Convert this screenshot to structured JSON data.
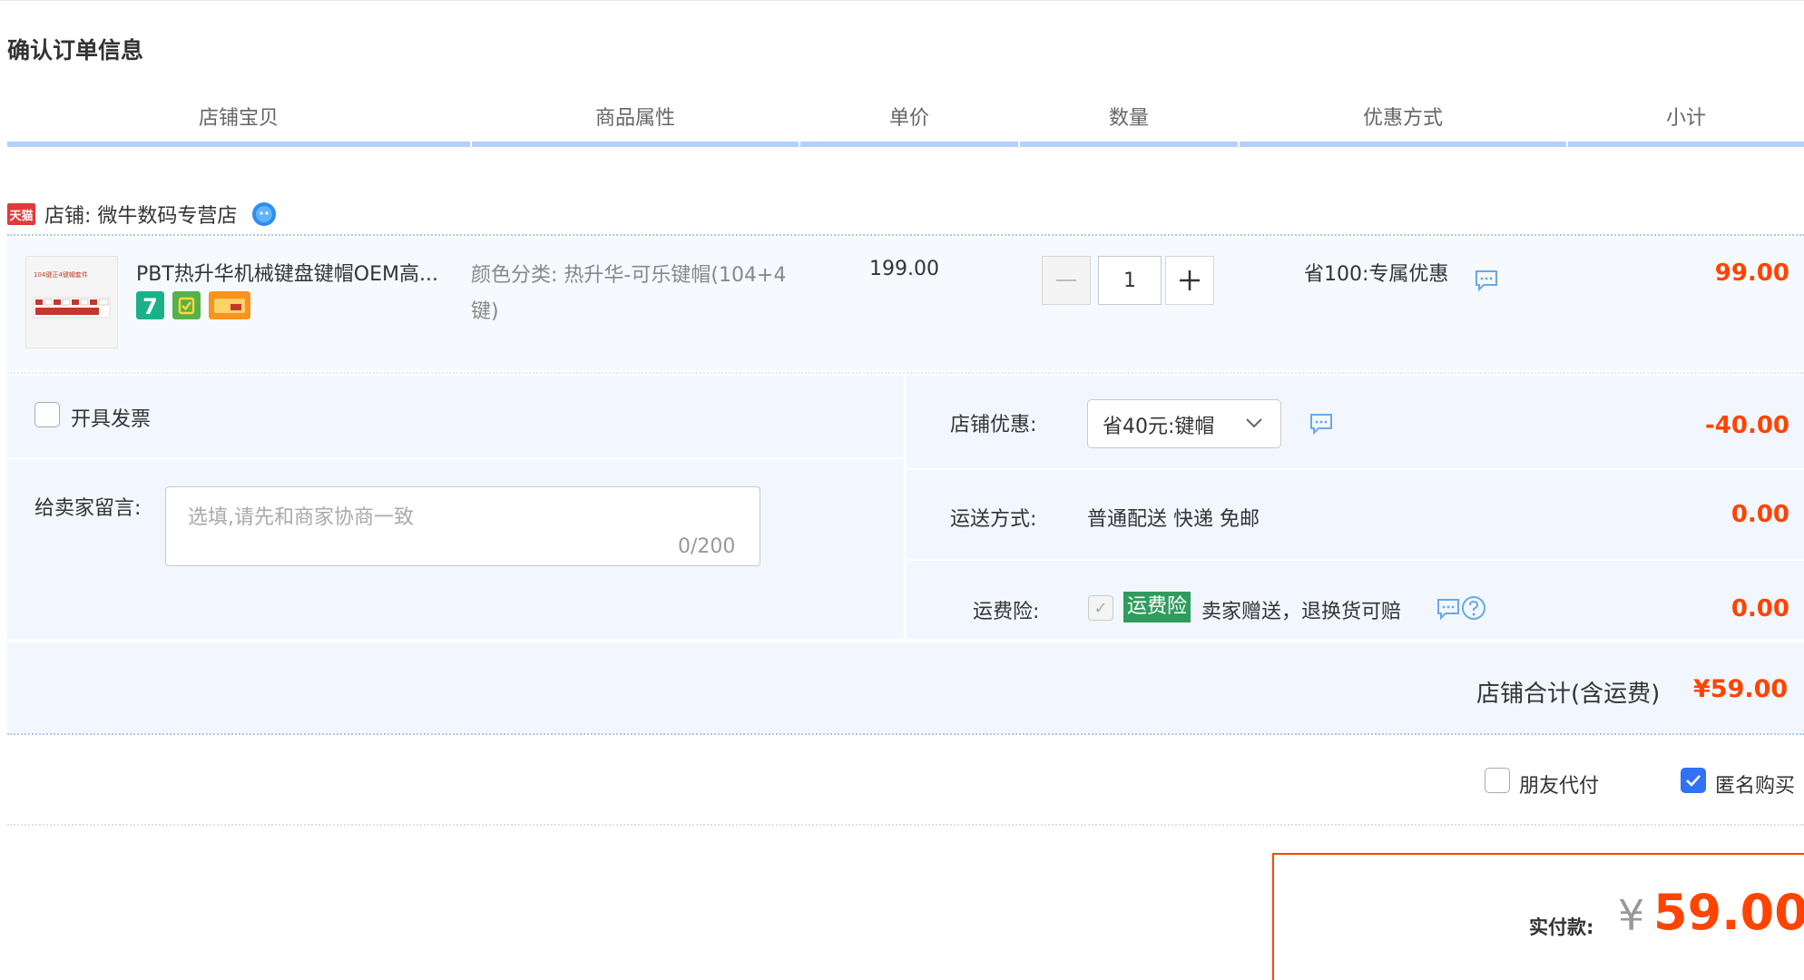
{
  "page_title": "确认订单信息",
  "columns": [
    "店铺宝贝",
    "商品属性",
    "单价",
    "数量",
    "优惠方式",
    "小计"
  ],
  "shop": {
    "badge": "天猫",
    "label": "店铺: 微牛数码专营店"
  },
  "item": {
    "title": "PBT热升华机械键盘键帽OEM高...",
    "thumb_text": "104键正4键帽套件",
    "attr_label": "颜色分类:",
    "attr_value": "热升华-可乐键帽(104+4键)",
    "price": "199.00",
    "quantity": "1",
    "promo": "省100:专属优惠",
    "subtotal": "99.00",
    "service_badges": [
      "7-day-return-icon",
      "guarantee-icon",
      "credit-card-icon"
    ],
    "service_badge_text": "7"
  },
  "invoice": {
    "label": "开具发票",
    "checked": false
  },
  "message": {
    "label": "给卖家留言:",
    "placeholder": "选填,请先和商家协商一致",
    "counter": "0/200"
  },
  "shop_discount": {
    "label": "店铺优惠:",
    "selected": "省40元:键帽",
    "amount": "-40.00"
  },
  "shipping": {
    "label": "运送方式:",
    "value": "普通配送 快递 免邮",
    "amount": "0.00"
  },
  "insurance": {
    "label": "运费险:",
    "tag": "运费险",
    "desc": "卖家赠送，退换货可赔",
    "amount": "0.00"
  },
  "shop_total": {
    "label": "店铺合计(含运费)",
    "value": "¥59.00"
  },
  "options": {
    "friend_pay": {
      "label": "朋友代付",
      "checked": false
    },
    "anonymous": {
      "label": "匿名购买",
      "checked": true
    }
  },
  "payment": {
    "label": "实付款:",
    "currency": "¥",
    "value": "59.00"
  },
  "colors": {
    "accent_red": "#ff4400",
    "header_underline": "#b2d1ff",
    "checkbox_blue": "#3072f6",
    "insurance_green": "#2f9c5d",
    "row_bg": "#f2f7ff"
  }
}
